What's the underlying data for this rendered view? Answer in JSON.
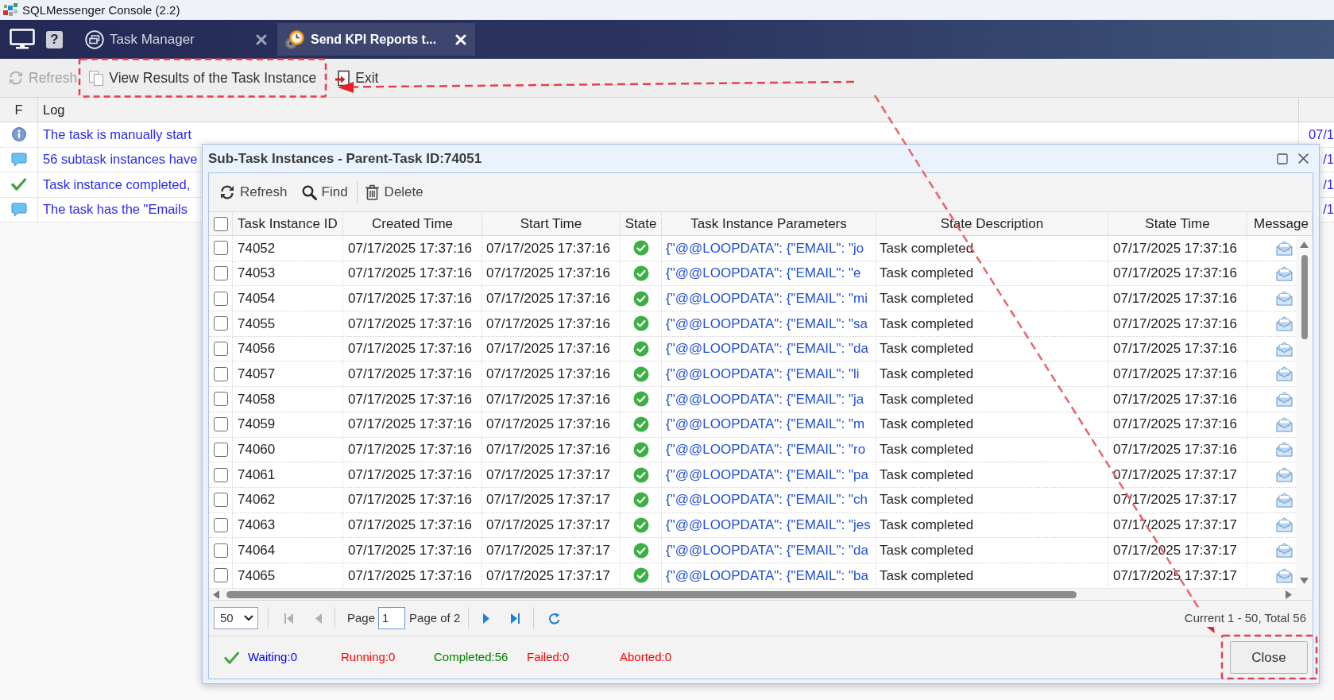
{
  "window": {
    "title": "SQLMessenger Console (2.2)"
  },
  "nav": {
    "help_glyph": "?",
    "tabs": [
      {
        "label": "Task Manager",
        "selected": false
      },
      {
        "label": "Send KPI Reports t...",
        "selected": true
      }
    ]
  },
  "toolbar": [
    {
      "label": "Refresh",
      "disabled": true
    },
    {
      "label": "View Results of the Task Instance",
      "disabled": false
    },
    {
      "label": "Exit",
      "disabled": false
    }
  ],
  "log": {
    "columns": [
      "F",
      "Log"
    ],
    "rows": [
      {
        "kind": "info",
        "text": "The task is manually start",
        "column_3": "07/1"
      },
      {
        "kind": "message",
        "text": "56 subtask instances have",
        "column_3": "/1"
      },
      {
        "kind": "success",
        "text": "Task instance completed,",
        "column_3": "/1"
      },
      {
        "kind": "message",
        "text": "The task has the \"Emails",
        "column_3": "/1"
      }
    ]
  },
  "dialog": {
    "title": "Sub-Task Instances - Parent-Task ID:74051",
    "toolbar": [
      "Refresh",
      "Find",
      "Delete"
    ],
    "table": {
      "all_checked": false,
      "columns": [
        "Task Instance ID",
        "Created Time",
        "Start Time",
        "State",
        "Task Instance Parameters",
        "State Description",
        "State Time",
        "Message"
      ],
      "rows": [
        {
          "checked": false,
          "id": "74052",
          "created_time": "07/17/2025 17:37:16",
          "start_time": "07/17/2025 17:37:16",
          "completed": true,
          "parameters": "{\"@@LOOPDATA\": {\"EMAIL\": \"jo",
          "state_description": "Task completed",
          "state_time": "07/17/2025 17:37:16"
        },
        {
          "checked": false,
          "id": "74053",
          "created_time": "07/17/2025 17:37:16",
          "start_time": "07/17/2025 17:37:16",
          "completed": true,
          "parameters": "{\"@@LOOPDATA\": {\"EMAIL\": \"e",
          "state_description": "Task completed",
          "state_time": "07/17/2025 17:37:16"
        },
        {
          "checked": false,
          "id": "74054",
          "created_time": "07/17/2025 17:37:16",
          "start_time": "07/17/2025 17:37:16",
          "completed": true,
          "parameters": "{\"@@LOOPDATA\": {\"EMAIL\": \"mi",
          "state_description": "Task completed",
          "state_time": "07/17/2025 17:37:16"
        },
        {
          "checked": false,
          "id": "74055",
          "created_time": "07/17/2025 17:37:16",
          "start_time": "07/17/2025 17:37:16",
          "completed": true,
          "parameters": "{\"@@LOOPDATA\": {\"EMAIL\": \"sa",
          "state_description": "Task completed",
          "state_time": "07/17/2025 17:37:16"
        },
        {
          "checked": false,
          "id": "74056",
          "created_time": "07/17/2025 17:37:16",
          "start_time": "07/17/2025 17:37:16",
          "completed": true,
          "parameters": "{\"@@LOOPDATA\": {\"EMAIL\": \"da",
          "state_description": "Task completed",
          "state_time": "07/17/2025 17:37:16"
        },
        {
          "checked": false,
          "id": "74057",
          "created_time": "07/17/2025 17:37:16",
          "start_time": "07/17/2025 17:37:16",
          "completed": true,
          "parameters": "{\"@@LOOPDATA\": {\"EMAIL\": \"li",
          "state_description": "Task completed",
          "state_time": "07/17/2025 17:37:16"
        },
        {
          "checked": false,
          "id": "74058",
          "created_time": "07/17/2025 17:37:16",
          "start_time": "07/17/2025 17:37:16",
          "completed": true,
          "parameters": "{\"@@LOOPDATA\": {\"EMAIL\": \"ja",
          "state_description": "Task completed",
          "state_time": "07/17/2025 17:37:16"
        },
        {
          "checked": false,
          "id": "74059",
          "created_time": "07/17/2025 17:37:16",
          "start_time": "07/17/2025 17:37:16",
          "completed": true,
          "parameters": "{\"@@LOOPDATA\": {\"EMAIL\": \"m",
          "state_description": "Task completed",
          "state_time": "07/17/2025 17:37:16"
        },
        {
          "checked": false,
          "id": "74060",
          "created_time": "07/17/2025 17:37:16",
          "start_time": "07/17/2025 17:37:16",
          "completed": true,
          "parameters": "{\"@@LOOPDATA\": {\"EMAIL\": \"ro",
          "state_description": "Task completed",
          "state_time": "07/17/2025 17:37:16"
        },
        {
          "checked": false,
          "id": "74061",
          "created_time": "07/17/2025 17:37:16",
          "start_time": "07/17/2025 17:37:17",
          "completed": true,
          "parameters": "{\"@@LOOPDATA\": {\"EMAIL\": \"pa",
          "state_description": "Task completed",
          "state_time": "07/17/2025 17:37:17"
        },
        {
          "checked": false,
          "id": "74062",
          "created_time": "07/17/2025 17:37:16",
          "start_time": "07/17/2025 17:37:17",
          "completed": true,
          "parameters": "{\"@@LOOPDATA\": {\"EMAIL\": \"ch",
          "state_description": "Task completed",
          "state_time": "07/17/2025 17:37:17"
        },
        {
          "checked": false,
          "id": "74063",
          "created_time": "07/17/2025 17:37:16",
          "start_time": "07/17/2025 17:37:17",
          "completed": true,
          "parameters": "{\"@@LOOPDATA\": {\"EMAIL\": \"jes",
          "state_description": "Task completed",
          "state_time": "07/17/2025 17:37:17"
        },
        {
          "checked": false,
          "id": "74064",
          "created_time": "07/17/2025 17:37:16",
          "start_time": "07/17/2025 17:37:17",
          "completed": true,
          "parameters": "{\"@@LOOPDATA\": {\"EMAIL\": \"da",
          "state_description": "Task completed",
          "state_time": "07/17/2025 17:37:17"
        },
        {
          "checked": false,
          "id": "74065",
          "created_time": "07/17/2025 17:37:16",
          "start_time": "07/17/2025 17:37:17",
          "completed": true,
          "parameters": "{\"@@LOOPDATA\": {\"EMAIL\": \"ba",
          "state_description": "Task completed",
          "state_time": "07/17/2025 17:37:17"
        }
      ]
    },
    "pager": {
      "page_size": "50",
      "page_label": "Page",
      "page": "1",
      "page_count": "Page of 2",
      "nav": [
        {
          "disabled": true
        },
        {
          "disabled": true
        },
        {
          "disabled": false
        },
        {
          "disabled": false
        }
      ],
      "summary": "Current 1 - 50, Total 56"
    },
    "status": [
      {
        "label": "Waiting:0",
        "color": "#0000ff"
      },
      {
        "label": "Running:0",
        "color": "#ff0000"
      },
      {
        "label": "Completed:56",
        "color": "#008000"
      },
      {
        "label": "Failed:0",
        "color": "#ff0000"
      },
      {
        "label": "Aborted:0",
        "color": "#ff0000"
      }
    ],
    "buttons": [
      "Close"
    ]
  }
}
